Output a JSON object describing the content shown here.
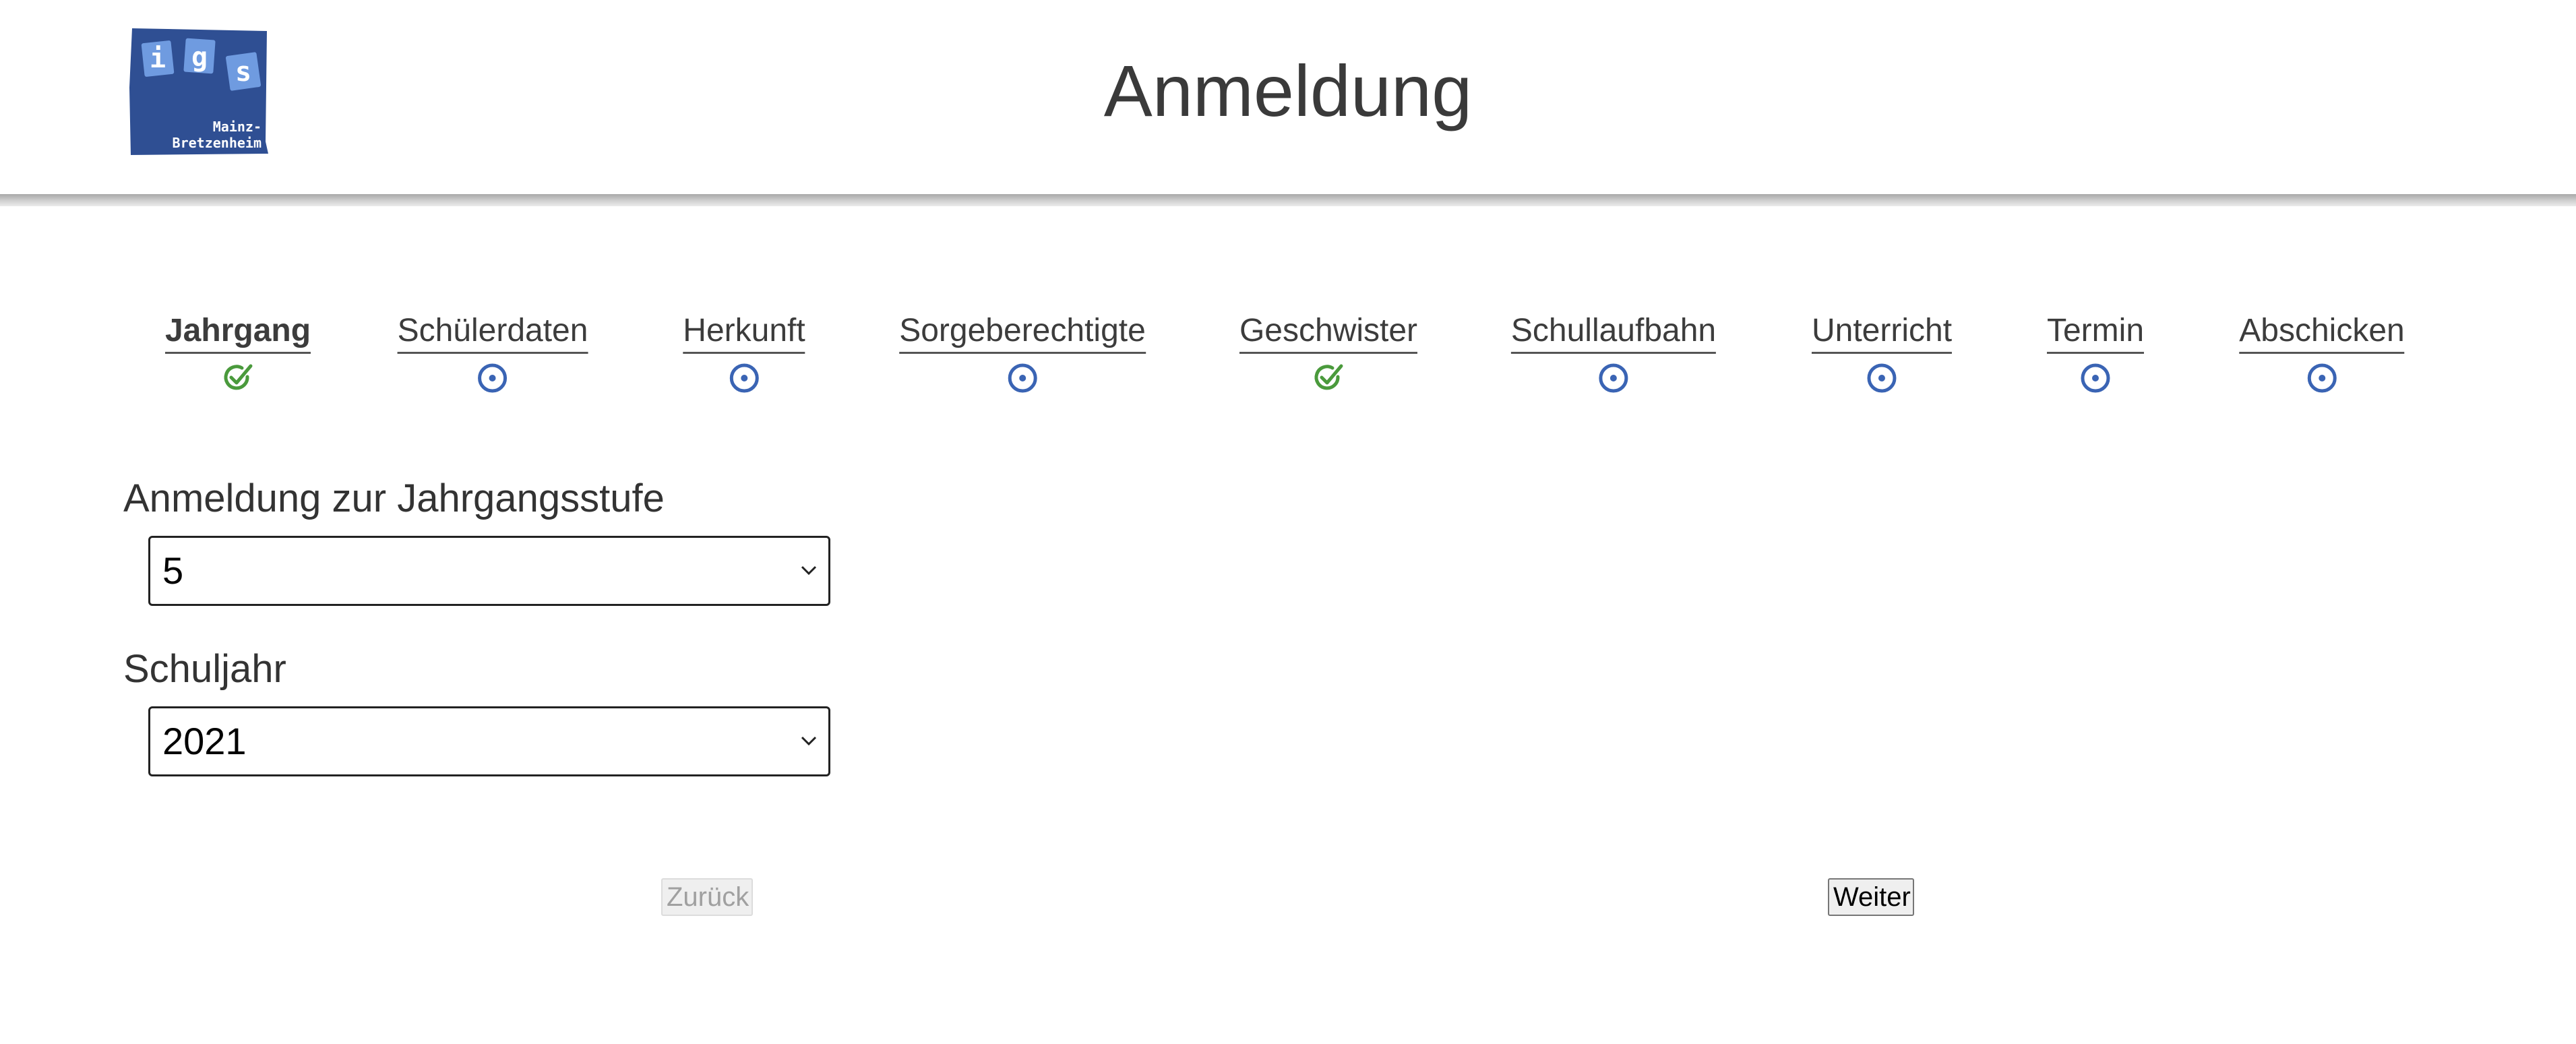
{
  "header": {
    "title": "Anmeldung",
    "logo": {
      "letters": [
        "i",
        "g",
        "s"
      ],
      "caption_line1": "Mainz-",
      "caption_line2": "Bretzenheim",
      "brand_color": "#2f4f93",
      "tile_color": "#6f9be0"
    }
  },
  "steps": [
    {
      "label": "Jahrgang",
      "status": "done",
      "icon": "check-circle-icon",
      "active": true
    },
    {
      "label": "Schülerdaten",
      "status": "open",
      "icon": "dot-circle-icon",
      "active": false
    },
    {
      "label": "Herkunft",
      "status": "open",
      "icon": "dot-circle-icon",
      "active": false
    },
    {
      "label": "Sorgeberechtigte",
      "status": "open",
      "icon": "dot-circle-icon",
      "active": false
    },
    {
      "label": "Geschwister",
      "status": "done",
      "icon": "check-circle-icon",
      "active": false
    },
    {
      "label": "Schullaufbahn",
      "status": "open",
      "icon": "dot-circle-icon",
      "active": false
    },
    {
      "label": "Unterricht",
      "status": "open",
      "icon": "dot-circle-icon",
      "active": false
    },
    {
      "label": "Termin",
      "status": "open",
      "icon": "dot-circle-icon",
      "active": false
    },
    {
      "label": "Abschicken",
      "status": "open",
      "icon": "dot-circle-icon",
      "active": false
    }
  ],
  "colors": {
    "done": "#4a9a3c",
    "open": "#3a64b4"
  },
  "form": {
    "grade": {
      "label": "Anmeldung zur Jahrgangsstufe",
      "value": "5"
    },
    "school_year": {
      "label": "Schuljahr",
      "value": "2021"
    }
  },
  "buttons": {
    "back_label": "Zurück",
    "back_disabled": true,
    "next_label": "Weiter"
  }
}
